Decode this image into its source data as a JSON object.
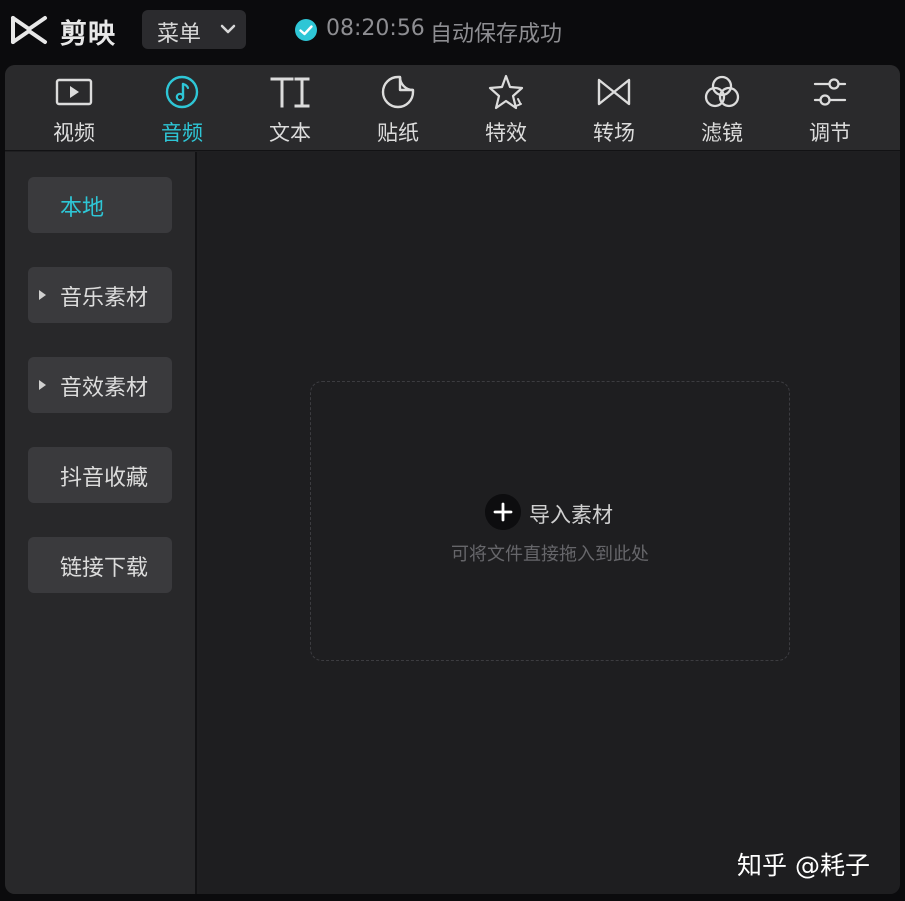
{
  "app": {
    "title": "剪映",
    "logo_icon": "capcut-logo-icon"
  },
  "menu": {
    "label": "菜单",
    "chevron_icon": "chevron-down-icon"
  },
  "save_status": {
    "icon": "check-circle-icon",
    "time": "08:20:56",
    "text": "自动保存成功",
    "accent_color": "#2ec6d6"
  },
  "toolbar": {
    "active_color": "#2ec6d6",
    "tools": [
      {
        "label": "视频",
        "icon": "video-icon",
        "active": false
      },
      {
        "label": "音频",
        "icon": "music-note-icon",
        "active": true
      },
      {
        "label": "文本",
        "icon": "text-icon",
        "active": false
      },
      {
        "label": "贴纸",
        "icon": "sticker-icon",
        "active": false
      },
      {
        "label": "特效",
        "icon": "sparkle-star-icon",
        "active": false
      },
      {
        "label": "转场",
        "icon": "transition-icon",
        "active": false
      },
      {
        "label": "滤镜",
        "icon": "filter-icon",
        "active": false
      },
      {
        "label": "调节",
        "icon": "adjust-sliders-icon",
        "active": false
      }
    ]
  },
  "sidebar": {
    "items": [
      {
        "label": "本地",
        "active": true,
        "expandable": false
      },
      {
        "label": "音乐素材",
        "active": false,
        "expandable": true
      },
      {
        "label": "音效素材",
        "active": false,
        "expandable": true
      },
      {
        "label": "抖音收藏",
        "active": false,
        "expandable": false
      },
      {
        "label": "链接下载",
        "active": false,
        "expandable": false
      }
    ]
  },
  "dropzone": {
    "import_label": "导入素材",
    "import_icon": "plus-icon",
    "hint": "可将文件直接拖入到此处"
  },
  "watermark": {
    "text": "知乎 @耗子"
  }
}
